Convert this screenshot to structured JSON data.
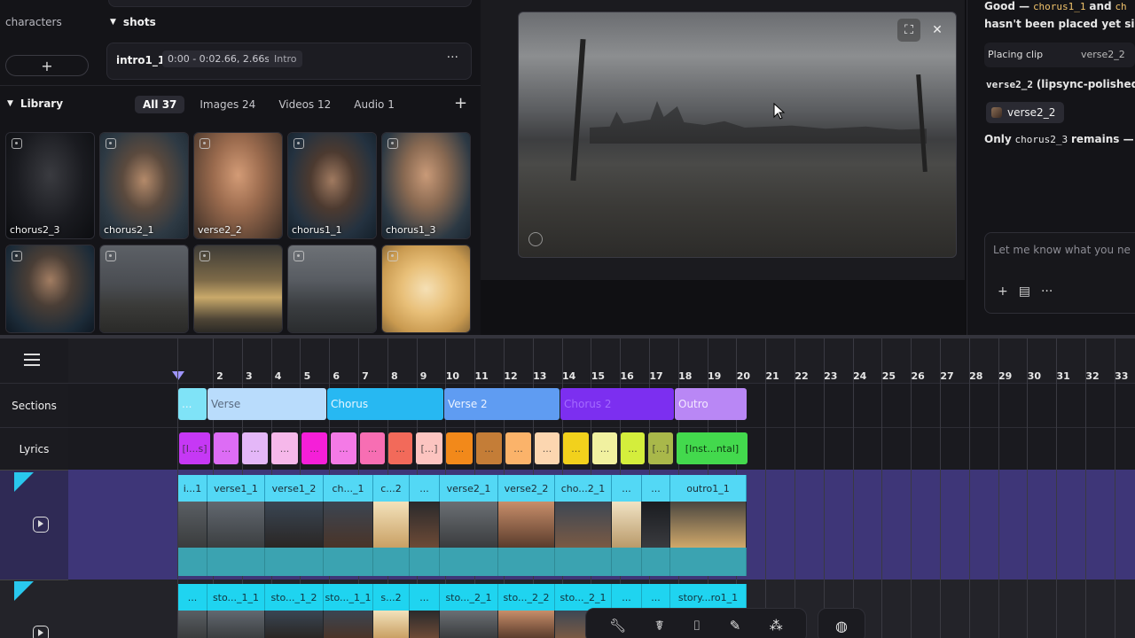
{
  "characters": {
    "label": "characters",
    "add_label": "+"
  },
  "shots": {
    "header": "shots",
    "card": {
      "name": "intro1_1",
      "time": "0:00 - 0:02.66, 2.66s",
      "tag": "Intro",
      "more": "···"
    }
  },
  "library": {
    "header": "Library",
    "tabs": [
      {
        "label": "All 37",
        "active": true
      },
      {
        "label": "Images 24",
        "active": false
      },
      {
        "label": "Videos 12",
        "active": false
      },
      {
        "label": "Audio 1",
        "active": false
      }
    ],
    "add": "+",
    "items": [
      {
        "caption": "chorus2_3"
      },
      {
        "caption": "chorus2_1"
      },
      {
        "caption": "verse2_2"
      },
      {
        "caption": "chorus1_1"
      },
      {
        "caption": "chorus1_3"
      },
      {
        "caption": ""
      },
      {
        "caption": ""
      },
      {
        "caption": ""
      },
      {
        "caption": ""
      },
      {
        "caption": ""
      }
    ]
  },
  "preview": {
    "expand": "⛶",
    "close": "✕"
  },
  "chat": {
    "line1_a": "Good —",
    "line1_code1": "chorus1_1",
    "line1_b": "and",
    "line1_code2": "ch",
    "line2": "hasn't been placed yet sinc",
    "placing_label": "Placing clip",
    "placing_value": "verse2_2",
    "line3_code": "verse2_2",
    "line3_text": "(lipsync-polished",
    "chip": "verse2_2",
    "line4_a": "Only",
    "line4_code": "chorus2_3",
    "line4_b": "remains —",
    "input_placeholder": "Let me know what you ne",
    "tools": [
      "+",
      "▤",
      "···"
    ]
  },
  "timeline": {
    "ticks": [
      "2",
      "3",
      "4",
      "5",
      "6",
      "7",
      "8",
      "9",
      "10",
      "11",
      "12",
      "13",
      "14",
      "15",
      "16",
      "17",
      "18",
      "19",
      "20",
      "21",
      "22",
      "23",
      "24",
      "25",
      "26",
      "27",
      "28",
      "29",
      "30",
      "31",
      "32",
      "33"
    ],
    "rows": {
      "sections": "Sections",
      "lyrics": "Lyrics"
    },
    "sections": [
      {
        "label": "...",
        "color": "#7fe3f7",
        "text": "#e8f7ff"
      },
      {
        "label": "Verse",
        "color": "#b9dcfc",
        "text": "#5a6b80"
      },
      {
        "label": "Chorus",
        "color": "#27b8f2",
        "text": "#e8f6ff"
      },
      {
        "label": "Verse 2",
        "color": "#5f9cf2",
        "text": "#eaf2ff"
      },
      {
        "label": "Chorus 2",
        "color": "#7c2ff0",
        "text": "#a46bff"
      },
      {
        "label": "Outro",
        "color": "#b987f5",
        "text": "#f3e9ff"
      }
    ],
    "lyrics": [
      {
        "label": "[I...s]",
        "color": "#c638f5"
      },
      {
        "label": "...",
        "color": "#dd6cf5"
      },
      {
        "label": "...",
        "color": "#e4b7f8"
      },
      {
        "label": "...",
        "color": "#f6b8ea"
      },
      {
        "label": "...",
        "color": "#f51fd8"
      },
      {
        "label": "...",
        "color": "#f47ae6"
      },
      {
        "label": "...",
        "color": "#f76eb3"
      },
      {
        "label": "...",
        "color": "#f26a5a"
      },
      {
        "label": "[...]",
        "color": "#fcc4c0"
      },
      {
        "label": "...",
        "color": "#f2891a"
      },
      {
        "label": "...",
        "color": "#c47d37"
      },
      {
        "label": "...",
        "color": "#fbb36a"
      },
      {
        "label": "...",
        "color": "#fcd6b0"
      },
      {
        "label": "...",
        "color": "#f2d11c"
      },
      {
        "label": "...",
        "color": "#f1f1a0"
      },
      {
        "label": "...",
        "color": "#d4ee3c"
      },
      {
        "label": "[...]",
        "color": "#a9b84a"
      },
      {
        "label": "[Inst...ntal]",
        "color": "#43d94d"
      }
    ],
    "video_clips": [
      "i...1",
      "verse1_1",
      "verse1_2",
      "ch..._1",
      "c...2",
      "...",
      "verse2_1",
      "verse2_2",
      "cho...2_1",
      "...",
      "...",
      "outro1_1"
    ],
    "video_clips2": [
      "...",
      "sto..._1_1",
      "sto..._1_2",
      "sto..._1_1",
      "s...2",
      "...",
      "sto..._2_1",
      "sto..._2_2",
      "sto..._2_1",
      "...",
      "...",
      "story...ro1_1"
    ]
  },
  "toolbar": {
    "icons": [
      "wrench-icon",
      "character-icon",
      "camera-icon",
      "magic-wand-icon",
      "apps-icon"
    ],
    "globe": "◍"
  }
}
